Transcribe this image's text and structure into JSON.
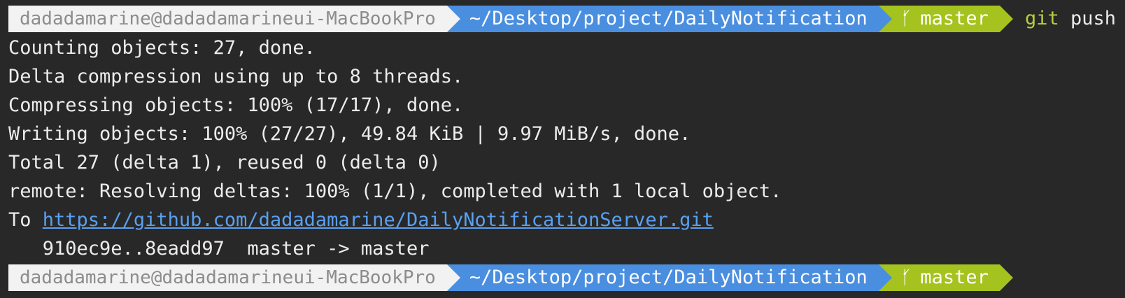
{
  "prompts": [
    {
      "user_host": "dadadamarine@dadadamarineui-MacBookPro",
      "path": "~/Desktop/project/DailyNotification",
      "branch_icon": "ᴸ",
      "branch": "master",
      "command": "git",
      "args": "push"
    },
    {
      "user_host": "dadadamarine@dadadamarineui-MacBookPro",
      "path": "~/Desktop/project/DailyNotification",
      "branch_icon": "ᴸ",
      "branch": "master"
    }
  ],
  "output": [
    "Counting objects: 27, done.",
    "Delta compression using up to 8 threads.",
    "Compressing objects: 100% (17/17), done.",
    "Writing objects: 100% (27/27), 49.84 KiB | 9.97 MiB/s, done.",
    "Total 27 (delta 1), reused 0 (delta 0)",
    "remote: Resolving deltas: 100% (1/1), completed with 1 local object."
  ],
  "remote_line": {
    "prefix": "To ",
    "url": "https://github.com/dadadamarine/DailyNotificationServer.git"
  },
  "ref_update": "   910ec9e..8eadd97  master -> master",
  "colors": {
    "background": "#282828",
    "user_segment": "#f2f2f2",
    "dir_segment": "#4a8ee0",
    "git_segment": "#a4c31e",
    "link": "#5aa0f0"
  }
}
